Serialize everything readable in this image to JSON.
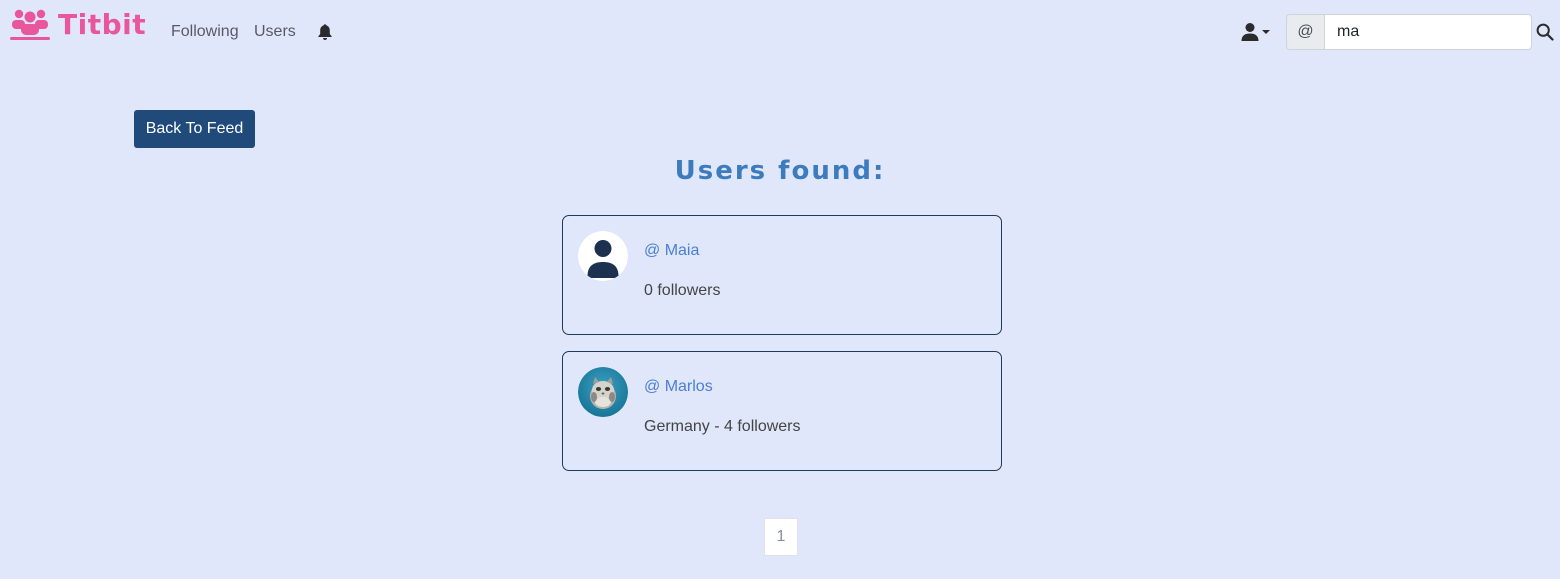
{
  "brand": {
    "name": "Titbit",
    "color": "#e8579b"
  },
  "nav": {
    "following_label": "Following",
    "users_label": "Users"
  },
  "search": {
    "prefix": "@",
    "value": "ma"
  },
  "main": {
    "back_button_label": "Back To Feed",
    "results_title": "Users found:",
    "accent_color": "#3d7bbf"
  },
  "results": [
    {
      "handle": "@ Maia",
      "meta": "0 followers",
      "avatar": "default-user-icon"
    },
    {
      "handle": "@ Marlos",
      "meta": "Germany - 4 followers",
      "avatar": "cat-photo"
    }
  ],
  "pagination": {
    "current_page": "1"
  }
}
